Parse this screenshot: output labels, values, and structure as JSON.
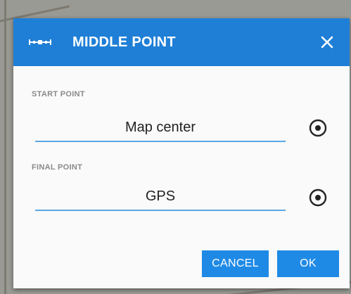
{
  "dialog": {
    "title": "MIDDLE POINT",
    "header_icon": "middle-point-icon",
    "close_icon": "close-icon",
    "accent_color": "#1f7fd6",
    "start": {
      "label": "START POINT",
      "value": "Map center",
      "icon": "target-icon"
    },
    "final": {
      "label": "FINAL POINT",
      "value": "GPS",
      "icon": "target-icon"
    },
    "buttons": {
      "cancel_label": "CANCEL",
      "ok_label": "OK"
    }
  }
}
